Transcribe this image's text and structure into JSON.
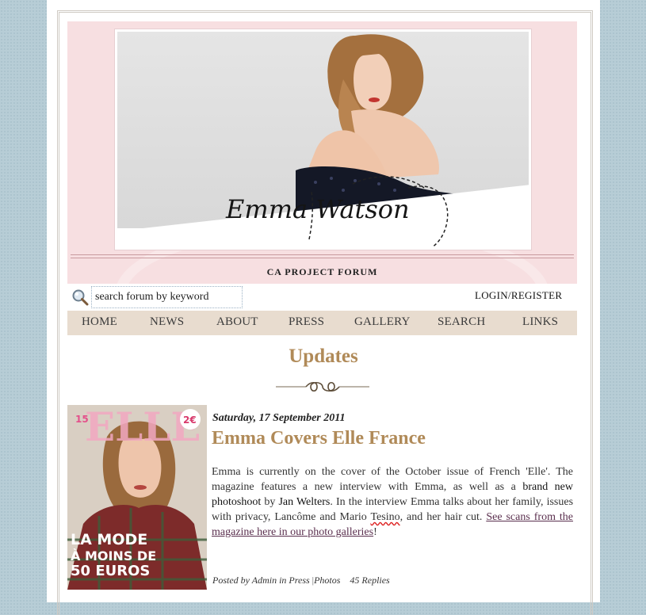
{
  "site": {
    "banner_name": "Emma Watson",
    "forum_title": "CA PROJECT FORUM"
  },
  "search": {
    "placeholder": "search forum by keyword",
    "value": "search forum by keyword"
  },
  "login_label": "LOGIN/REGISTER",
  "nav": {
    "items": [
      "HOME",
      "NEWS",
      "ABOUT",
      "PRESS",
      "GALLERY",
      "SEARCH",
      "LINKS"
    ]
  },
  "section_title": "Updates",
  "post": {
    "date": "Saturday, 17 September 2011",
    "title": "Emma Covers Elle France",
    "body": {
      "p1": "Emma is currently on the cover of the October issue of French 'Elle'. The magazine features a new interview with Emma, as well as a ",
      "link1": "brand new photoshoot",
      "p2": " by ",
      "link2": "Jan Welters",
      "p3": ". In the interview Emma talks about her family, issues with privacy, Lancôme and Mario ",
      "name": "Tesino",
      "p4": ", and her hair cut. ",
      "link3": "See scans from the magazine here in our photo galleries",
      "p5": "!"
    },
    "meta": {
      "posted_by": "Posted by Admin in Press",
      "sep": "|",
      "category": "Photos",
      "replies": "45 Replies"
    },
    "cover": {
      "masthead": "ELLE",
      "badge": "15",
      "price": "2€",
      "line1": "LA MODE",
      "line2": "À MOINS DE",
      "line3": "50 EUROS"
    }
  },
  "colors": {
    "accent": "#b08a58",
    "header_pink": "#f7dfe1",
    "nav_bg": "#e8dccf",
    "page_bg": "#b7cdd6"
  }
}
